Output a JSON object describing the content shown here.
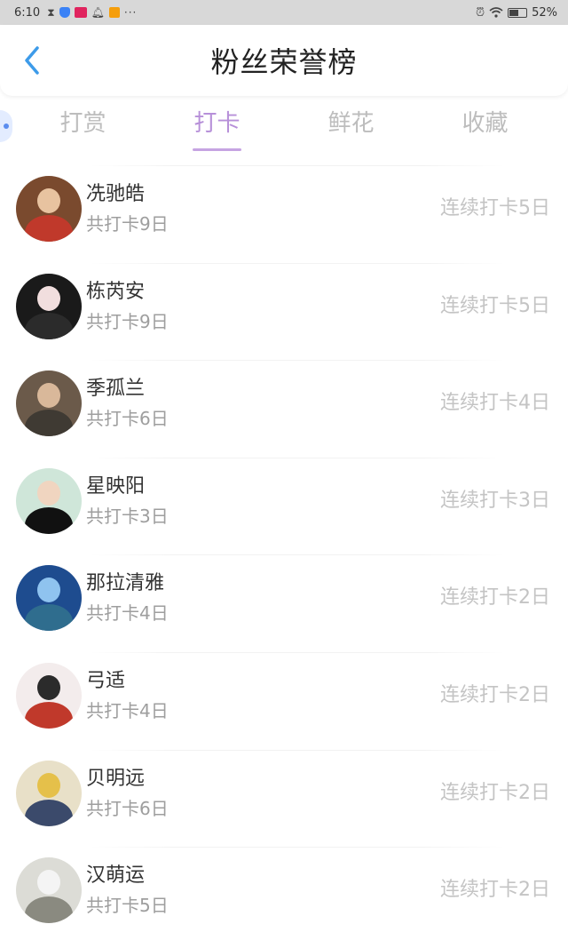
{
  "status_bar": {
    "time": "6:10",
    "dots": "···",
    "battery_percent": "52%",
    "battery_level": 0.52,
    "icons": [
      "hourglass-icon",
      "shield-icon",
      "app-icon",
      "bell-icon",
      "play-icon",
      "alarm-icon",
      "wifi-icon",
      "battery-icon"
    ]
  },
  "header": {
    "title": "粉丝荣誉榜",
    "back_icon": "chevron-left-icon"
  },
  "tabs": [
    {
      "label": "打赏",
      "active": false
    },
    {
      "label": "打卡",
      "active": true
    },
    {
      "label": "鲜花",
      "active": false
    },
    {
      "label": "收藏",
      "active": false
    }
  ],
  "colors": {
    "accent": "#c6a4e2",
    "accent_text": "#b790d9",
    "status_bar_bg": "#d8d8d8",
    "back_arrow": "#3d9be9"
  },
  "list": [
    {
      "name": "冼驰皓",
      "total": "共打卡9日",
      "streak": "连续打卡5日",
      "avatar": {
        "bg": "#7a4a2e",
        "head": "#e8c3a0",
        "body": "#c0392b"
      }
    },
    {
      "name": "栋芮安",
      "total": "共打卡9日",
      "streak": "连续打卡5日",
      "avatar": {
        "bg": "#1a1a1a",
        "head": "#f1dede",
        "body": "#2b2b2b"
      }
    },
    {
      "name": "季孤兰",
      "total": "共打卡6日",
      "streak": "连续打卡4日",
      "avatar": {
        "bg": "#6b5a4a",
        "head": "#d9b89a",
        "body": "#3f3a33"
      }
    },
    {
      "name": "星映阳",
      "total": "共打卡3日",
      "streak": "连续打卡3日",
      "avatar": {
        "bg": "#cfe6d9",
        "head": "#f0d5c0",
        "body": "#111111"
      }
    },
    {
      "name": "那拉清雅",
      "total": "共打卡4日",
      "streak": "连续打卡2日",
      "avatar": {
        "bg": "#1e4c8f",
        "head": "#8fc3ef",
        "body": "#2f6d8e"
      }
    },
    {
      "name": "弓适",
      "total": "共打卡4日",
      "streak": "连续打卡2日",
      "avatar": {
        "bg": "#f3ecec",
        "head": "#2b2b2b",
        "body": "#c0392b"
      }
    },
    {
      "name": "贝明远",
      "total": "共打卡6日",
      "streak": "连续打卡2日",
      "avatar": {
        "bg": "#e8e0c8",
        "head": "#e5c04a",
        "body": "#3b4a6b"
      }
    },
    {
      "name": "汉萌运",
      "total": "共打卡5日",
      "streak": "连续打卡2日",
      "avatar": {
        "bg": "#dcdcd6",
        "head": "#f4f4f4",
        "body": "#8a8a80"
      }
    }
  ]
}
